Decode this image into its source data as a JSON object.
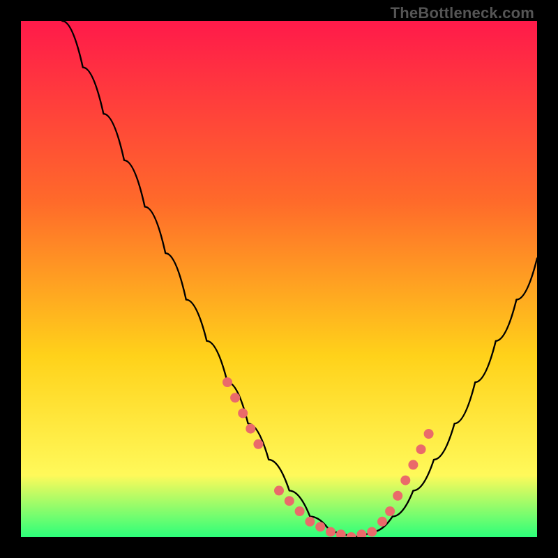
{
  "watermark": "TheBottleneck.com",
  "colors": {
    "bg": "#000000",
    "grad_top": "#ff1a4a",
    "grad_mid1": "#ff6a2a",
    "grad_mid2": "#ffd21a",
    "grad_mid3": "#fff95a",
    "grad_bottom": "#2cff7a",
    "curve": "#000000",
    "dot": "#ea6a6a"
  },
  "chart_data": {
    "type": "line",
    "title": "",
    "xlabel": "",
    "ylabel": "",
    "xlim": [
      0,
      100
    ],
    "ylim": [
      0,
      100
    ],
    "series": [
      {
        "name": "bottleneck-curve",
        "x": [
          8,
          12,
          16,
          20,
          24,
          28,
          32,
          36,
          40,
          44,
          48,
          52,
          56,
          60,
          64,
          68,
          72,
          76,
          80,
          84,
          88,
          92,
          96,
          100
        ],
        "values": [
          100,
          91,
          82,
          73,
          64,
          55,
          46,
          38,
          30,
          22,
          15,
          9,
          4,
          1,
          0,
          1,
          4,
          9,
          15,
          22,
          30,
          38,
          46,
          54
        ]
      }
    ],
    "highlight_points": {
      "name": "highlight-dots",
      "x": [
        40,
        41.5,
        43,
        44.5,
        46,
        50,
        52,
        54,
        56,
        58,
        60,
        62,
        64,
        66,
        68,
        70,
        71.5,
        73,
        74.5,
        76,
        77.5,
        79
      ],
      "values": [
        30,
        27,
        24,
        21,
        18,
        9,
        7,
        5,
        3,
        2,
        1,
        0.5,
        0,
        0.5,
        1,
        3,
        5,
        8,
        11,
        14,
        17,
        20
      ]
    },
    "bottom_band": {
      "y_from": 0,
      "y_to": 6
    }
  }
}
